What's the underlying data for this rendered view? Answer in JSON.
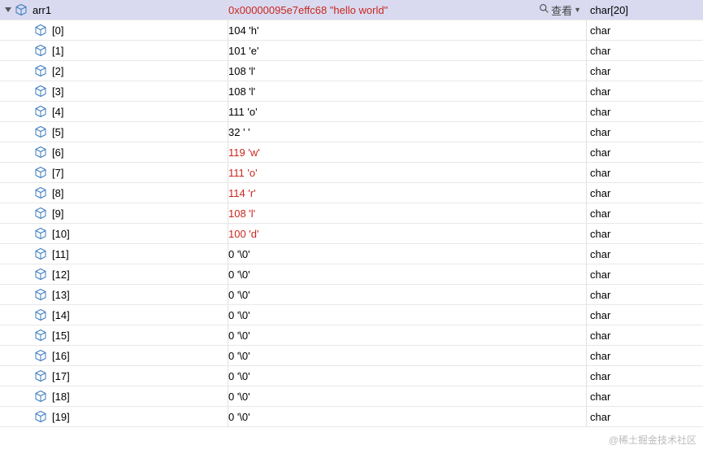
{
  "watermark": "@稀土掘金技术社区",
  "viewAction": "查看",
  "root": {
    "name": "arr1",
    "value": "0x00000095e7effc68 \"hello world\"",
    "type": "char[20]"
  },
  "items": [
    {
      "name": "[0]",
      "value": "104 'h'",
      "type": "char",
      "changed": false
    },
    {
      "name": "[1]",
      "value": "101 'e'",
      "type": "char",
      "changed": false
    },
    {
      "name": "[2]",
      "value": "108 'l'",
      "type": "char",
      "changed": false
    },
    {
      "name": "[3]",
      "value": "108 'l'",
      "type": "char",
      "changed": false
    },
    {
      "name": "[4]",
      "value": "111 'o'",
      "type": "char",
      "changed": false
    },
    {
      "name": "[5]",
      "value": "32 ' '",
      "type": "char",
      "changed": false
    },
    {
      "name": "[6]",
      "value": "119 'w'",
      "type": "char",
      "changed": true
    },
    {
      "name": "[7]",
      "value": "111 'o'",
      "type": "char",
      "changed": true
    },
    {
      "name": "[8]",
      "value": "114 'r'",
      "type": "char",
      "changed": true
    },
    {
      "name": "[9]",
      "value": "108 'l'",
      "type": "char",
      "changed": true
    },
    {
      "name": "[10]",
      "value": "100 'd'",
      "type": "char",
      "changed": true
    },
    {
      "name": "[11]",
      "value": "0 '\\0'",
      "type": "char",
      "changed": false
    },
    {
      "name": "[12]",
      "value": "0 '\\0'",
      "type": "char",
      "changed": false
    },
    {
      "name": "[13]",
      "value": "0 '\\0'",
      "type": "char",
      "changed": false
    },
    {
      "name": "[14]",
      "value": "0 '\\0'",
      "type": "char",
      "changed": false
    },
    {
      "name": "[15]",
      "value": "0 '\\0'",
      "type": "char",
      "changed": false
    },
    {
      "name": "[16]",
      "value": "0 '\\0'",
      "type": "char",
      "changed": false
    },
    {
      "name": "[17]",
      "value": "0 '\\0'",
      "type": "char",
      "changed": false
    },
    {
      "name": "[18]",
      "value": "0 '\\0'",
      "type": "char",
      "changed": false
    },
    {
      "name": "[19]",
      "value": "0 '\\0'",
      "type": "char",
      "changed": false
    }
  ]
}
